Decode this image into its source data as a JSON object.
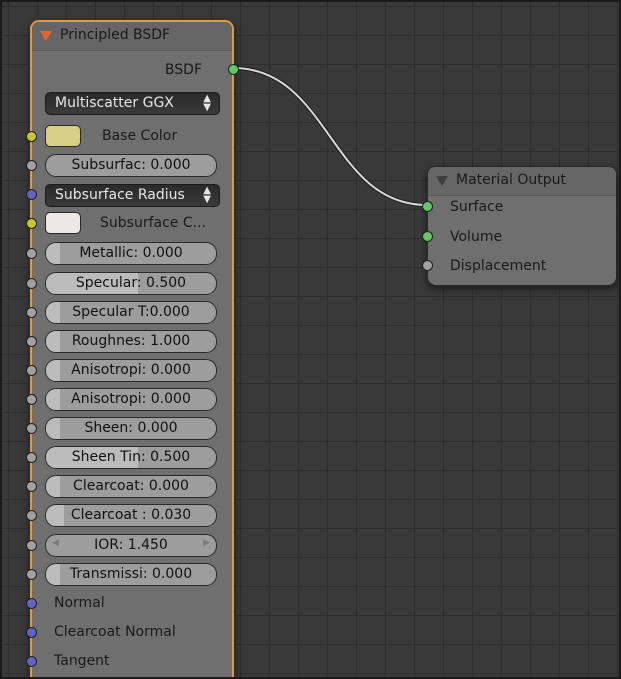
{
  "principled_node": {
    "title": "Principled BSDF",
    "output_label": "BSDF",
    "distribution": "Multiscatter GGX",
    "base_color": {
      "label": "Base Color",
      "color": "#d7cf85"
    },
    "subsurface": "Subsurfac: 0.000",
    "subsurface_radius": "Subsurface Radius",
    "subsurface_color": {
      "label": "Subsurface C...",
      "color": "#ece8e5"
    },
    "fields": {
      "metallic": {
        "text": "Metallic:     0.000",
        "value": 0.0
      },
      "specular": {
        "text": "Specular:  0.500",
        "value": 0.5
      },
      "specular_tint": {
        "text": "Specular T:0.000",
        "value": 0.0
      },
      "roughness": {
        "text": "Roughnes: 1.000",
        "value": 1.0
      },
      "anisotropic": {
        "text": "Anisotropi: 0.000",
        "value": 0.0
      },
      "anisotropic_rotation": {
        "text": "Anisotropi: 0.000",
        "value": 0.0
      },
      "sheen": {
        "text": "Sheen:       0.000",
        "value": 0.0
      },
      "sheen_tint": {
        "text": "Sheen Tin: 0.500",
        "value": 0.5
      },
      "clearcoat": {
        "text": "Clearcoat: 0.000",
        "value": 0.0
      },
      "clearcoat_roughness": {
        "text": "Clearcoat : 0.030",
        "value": 0.03
      },
      "ior": {
        "text": "IOR:           1.450"
      },
      "transmission": {
        "text": "Transmissi: 0.000",
        "value": 0.0
      }
    },
    "inputs": {
      "normal": "Normal",
      "clearcoat_normal": "Clearcoat Normal",
      "tangent": "Tangent"
    }
  },
  "material_output_node": {
    "title": "Material Output",
    "inputs": {
      "surface": "Surface",
      "volume": "Volume",
      "displacement": "Displacement"
    }
  },
  "colors": {
    "node_border_active": "#e39a3c",
    "collapse_triangle": "#e8642a",
    "socket_shader": "#63c763",
    "socket_value": "#a1a1a1",
    "socket_color": "#c7c729",
    "socket_vector": "#6363c7"
  }
}
